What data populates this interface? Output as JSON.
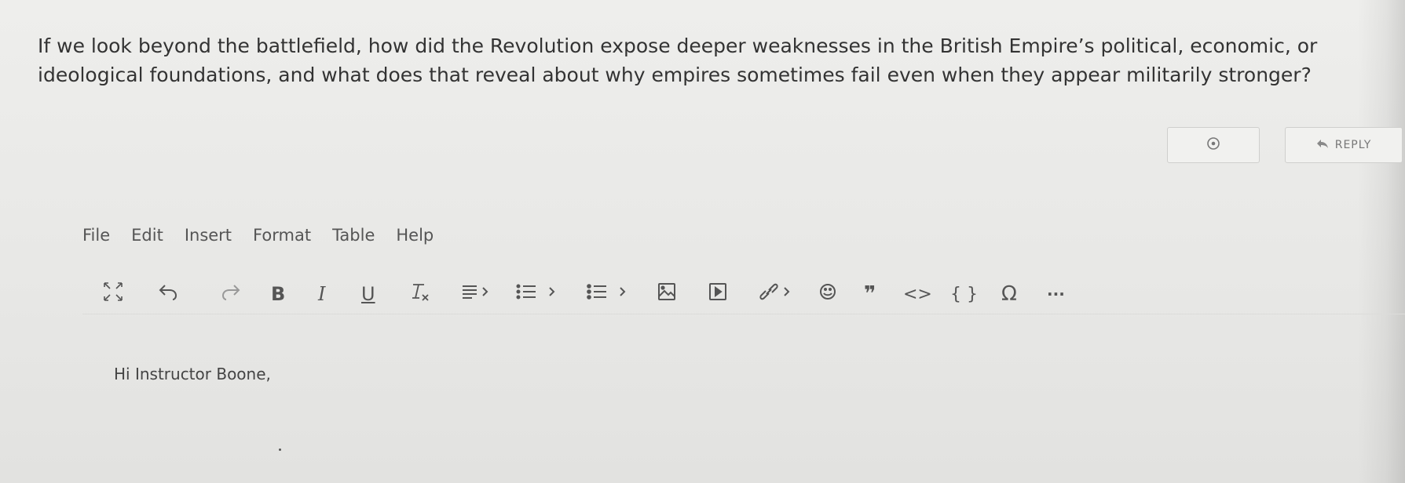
{
  "question": {
    "text": "If we look beyond the battlefield, how did the Revolution expose deeper weaknesses in the British Empire’s political, economic, or ideological foundations, and what does that reveal about why empires sometimes fail even when they appear militarily stronger?"
  },
  "actions": {
    "reply_label": "REPLY"
  },
  "editor": {
    "menu": [
      "File",
      "Edit",
      "Insert",
      "Format",
      "Table",
      "Help"
    ],
    "toolbar": {
      "bold": "B",
      "italic": "I",
      "underline": "U",
      "quote": "❞",
      "code": "<>",
      "codeblock": "{ }",
      "omega": "Ω",
      "more": "···"
    },
    "content": "Hi Instructor Boone,"
  }
}
